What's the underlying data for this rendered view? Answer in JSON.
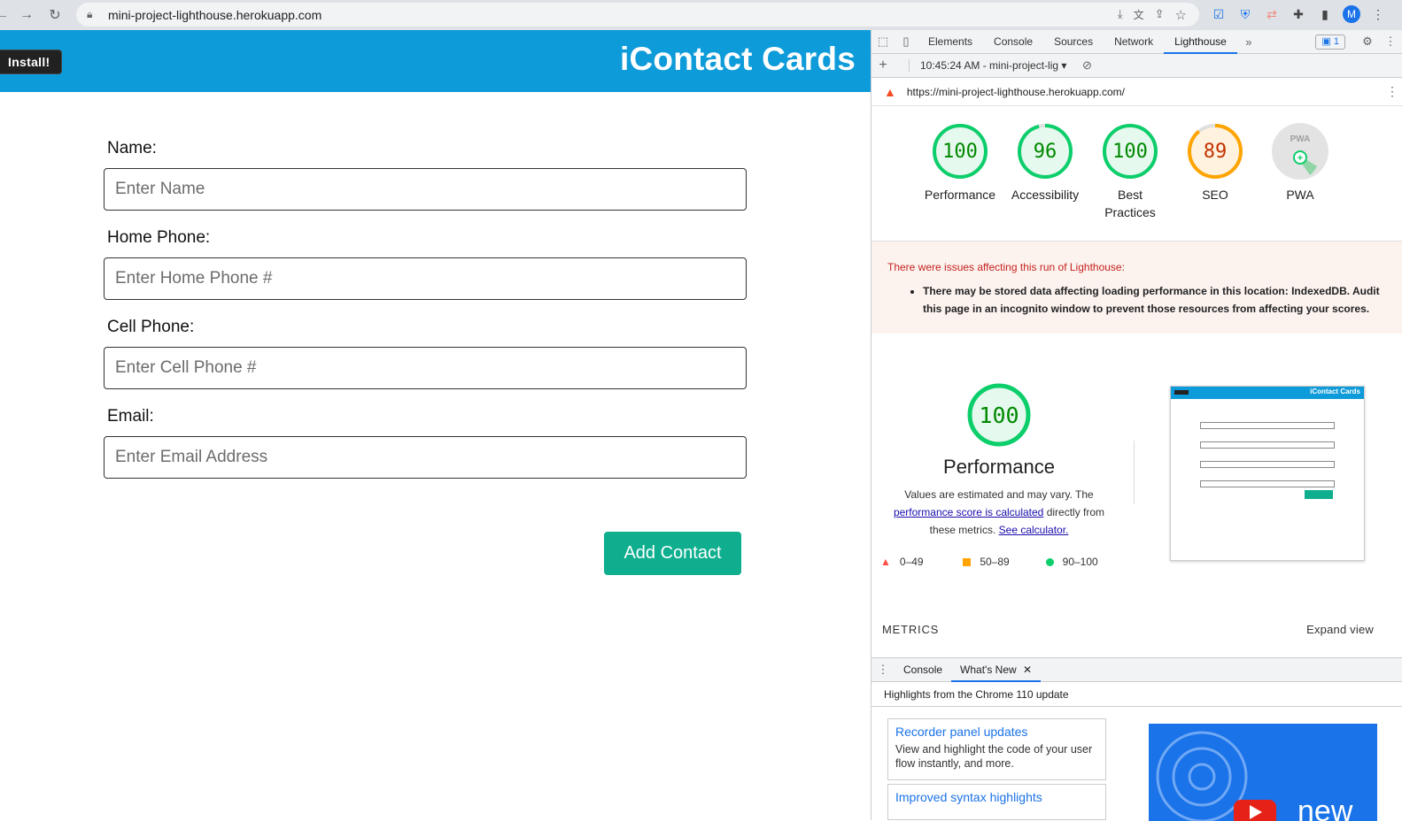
{
  "browser": {
    "url": "mini-project-lighthouse.herokuapp.com",
    "avatar": "M"
  },
  "page": {
    "install_button": "Install!",
    "brand": "iContact Cards",
    "fields": [
      {
        "label": "Name:",
        "placeholder": "Enter Name"
      },
      {
        "label": "Home Phone:",
        "placeholder": "Enter Home Phone #"
      },
      {
        "label": "Cell Phone:",
        "placeholder": "Enter Cell Phone #"
      },
      {
        "label": "Email:",
        "placeholder": "Enter Email Address"
      }
    ],
    "add_button": "Add Contact"
  },
  "devtools": {
    "tabs": [
      "Elements",
      "Console",
      "Sources",
      "Network",
      "Lighthouse"
    ],
    "active_tab": "Lighthouse",
    "issues_count": "1",
    "report_selector": "10:45:24 AM - mini-project-lig",
    "report_url": "https://mini-project-lighthouse.herokuapp.com/",
    "scores": [
      {
        "value": "100",
        "label": "Performance",
        "color": "#0cce6b",
        "text": "#008800",
        "fraction": 1.0
      },
      {
        "value": "96",
        "label": "Accessibility",
        "color": "#0cce6b",
        "text": "#008800",
        "fraction": 0.96
      },
      {
        "value": "100",
        "label": "Best Practices",
        "color": "#0cce6b",
        "text": "#008800",
        "fraction": 1.0
      },
      {
        "value": "89",
        "label": "SEO",
        "color": "#ffa400",
        "text": "#c33300",
        "fraction": 0.89
      }
    ],
    "pwa_label": "PWA",
    "pwa_badge": "PWA",
    "warning_title": "There were issues affecting this run of Lighthouse:",
    "warning_item": "There may be stored data affecting loading performance in this location: IndexedDB. Audit this page in an incognito window to prevent those resources from affecting your scores.",
    "perf_score": "100",
    "perf_title": "Performance",
    "perf_desc_1": "Values are estimated and may vary. The",
    "perf_link_1": "performance score is calculated",
    "perf_desc_2": "directly from these metrics.",
    "perf_link_2": "See calculator.",
    "legend": [
      "0–49",
      "50–89",
      "90–100"
    ],
    "thumb_brand": "iContact Cards",
    "metrics_label": "METRICS",
    "expand_view": "Expand view",
    "drawer_tabs": [
      "Console",
      "What's New"
    ],
    "highlights": "Highlights from the Chrome 110 update",
    "cards": [
      {
        "title": "Recorder panel updates",
        "desc": "View and highlight the code of your user flow instantly, and more."
      },
      {
        "title": "Improved syntax highlights",
        "desc": ""
      }
    ],
    "video_text": "new"
  }
}
